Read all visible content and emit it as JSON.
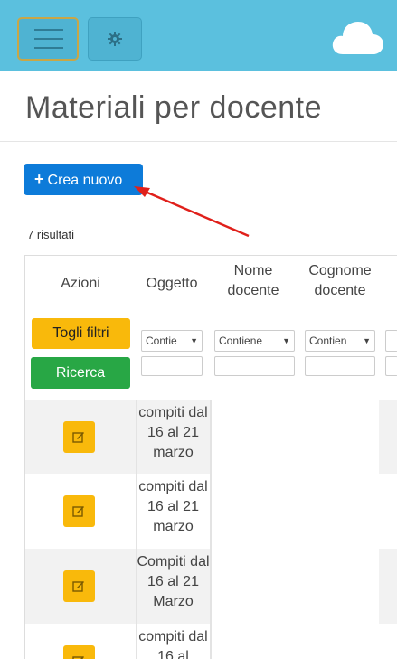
{
  "topbar": {
    "menu_icon": "hamburger-icon",
    "settings_icon": "gear-icon",
    "logo_icon": "cloud-icon",
    "color": "#5bc0de"
  },
  "page": {
    "title": "Materiali per docente"
  },
  "actions": {
    "create_label": "Crea nuovo",
    "create_icon": "plus-icon"
  },
  "results_text": "7 risultati",
  "table": {
    "headers": {
      "actions": "Azioni",
      "subject": "Oggetto",
      "teacher_first_name": "Nome docente",
      "teacher_last_name": "Cognome docente"
    },
    "filters": {
      "clear_label": "Togli filtri",
      "search_label": "Ricerca",
      "subject_operator": "Contie",
      "first_name_operator": "Contiene",
      "last_name_operator": "Contien"
    },
    "rows": [
      {
        "subject": "compiti dal 16 al 21 marzo"
      },
      {
        "subject": "compiti dal 16 al 21 marzo"
      },
      {
        "subject": "Compiti dal 16 al 21 Marzo"
      },
      {
        "subject": "compiti dal 16 al"
      }
    ]
  }
}
